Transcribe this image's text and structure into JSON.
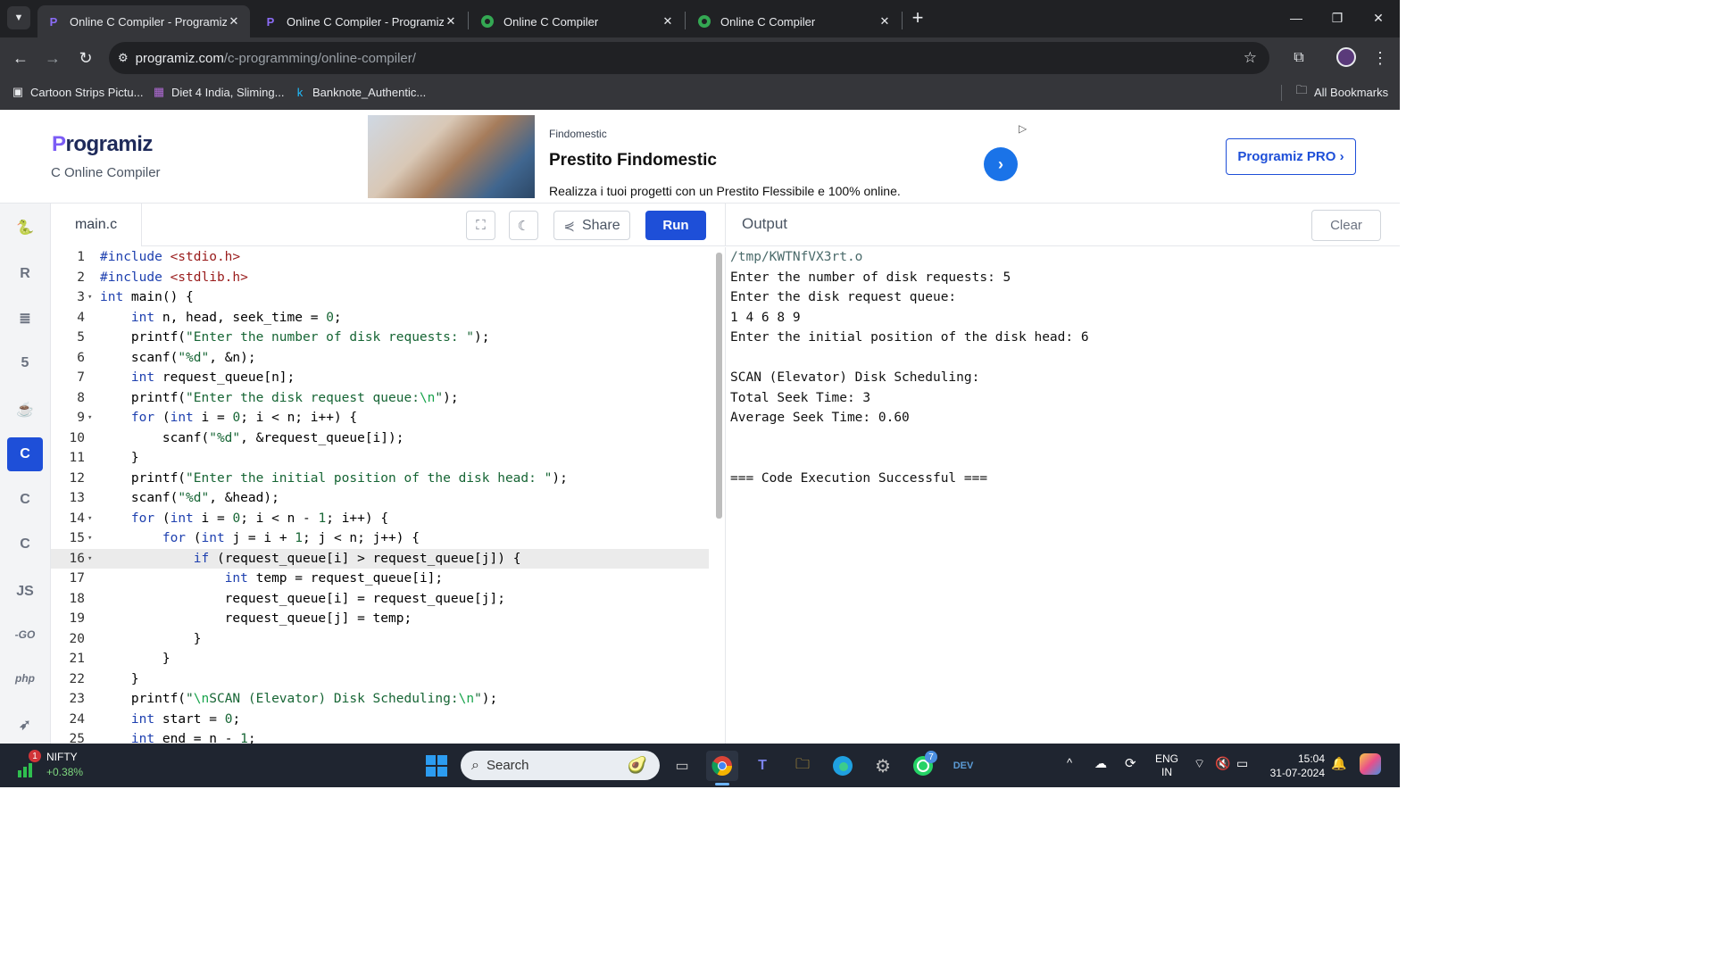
{
  "browser": {
    "tabs": [
      {
        "title": "Online C Compiler - Programiz",
        "icon": "programiz-icon",
        "active": true
      },
      {
        "title": "Online C Compiler - Programiz",
        "icon": "programiz-icon",
        "active": false
      },
      {
        "title": "Online C Compiler",
        "icon": "onlinegdb-icon",
        "active": false
      },
      {
        "title": "Online C Compiler",
        "icon": "onlinegdb-icon",
        "active": false
      }
    ],
    "new_tab": "+",
    "url_host": "programiz.com",
    "url_path": "/c-programming/online-compiler/",
    "bookmarks": [
      "Cartoon Strips Pictu...",
      "Diet 4 India, Sliming...",
      "Banknote_Authentic..."
    ],
    "all_bookmarks": "All Bookmarks"
  },
  "header": {
    "logo": "rogramiz",
    "logo_p": "P",
    "subtitle": "C Online Compiler",
    "pro_button": "Programiz PRO ›"
  },
  "ad": {
    "brand": "Findomestic",
    "title": "Prestito Findomestic",
    "desc": "Realizza i tuoi progetti con un Prestito Flessibile e 100% online."
  },
  "rail": {
    "items": [
      {
        "name": "python-icon",
        "glyph": "🐍",
        "active": false
      },
      {
        "name": "r-icon",
        "glyph": "R",
        "active": false
      },
      {
        "name": "sql-icon",
        "glyph": "≣",
        "active": false
      },
      {
        "name": "html-icon",
        "glyph": "5",
        "active": false
      },
      {
        "name": "java-icon",
        "glyph": "☕",
        "active": false
      },
      {
        "name": "c-icon",
        "glyph": "C",
        "active": true
      },
      {
        "name": "cpp-icon",
        "glyph": "C",
        "active": false
      },
      {
        "name": "csharp-icon",
        "glyph": "C",
        "active": false
      },
      {
        "name": "js-icon",
        "glyph": "JS",
        "active": false
      },
      {
        "name": "go-icon",
        "glyph": "-GO",
        "active": false
      },
      {
        "name": "php-icon",
        "glyph": "php",
        "active": false
      },
      {
        "name": "swift-icon",
        "glyph": "➶",
        "active": false
      }
    ]
  },
  "editor": {
    "filename": "main.c",
    "share_label": "Share",
    "run_label": "Run",
    "lines": [
      {
        "n": "1",
        "fold": false,
        "html": "<span class=\"pp\">#include</span> <span class=\"inc\">&lt;stdio.h&gt;</span>"
      },
      {
        "n": "2",
        "fold": false,
        "html": "<span class=\"pp\">#include</span> <span class=\"inc\">&lt;stdlib.h&gt;</span>"
      },
      {
        "n": "3",
        "fold": true,
        "html": "<span class=\"kw\">int</span> main() {"
      },
      {
        "n": "4",
        "fold": false,
        "html": "    <span class=\"kw\">int</span> n, head, seek_time = <span class=\"num\">0</span>;"
      },
      {
        "n": "5",
        "fold": false,
        "html": "    printf(<span class=\"str\">\"Enter the number of disk requests: \"</span>);"
      },
      {
        "n": "6",
        "fold": false,
        "html": "    scanf(<span class=\"str\">\"%d\"</span>, &amp;n);"
      },
      {
        "n": "7",
        "fold": false,
        "html": "    <span class=\"kw\">int</span> request_queue[n];"
      },
      {
        "n": "8",
        "fold": false,
        "html": "    printf(<span class=\"str\">\"Enter the disk request queue:<span class=\"esc\">\\n</span>\"</span>);"
      },
      {
        "n": "9",
        "fold": true,
        "html": "    <span class=\"kw\">for</span> (<span class=\"kw\">int</span> i = <span class=\"num\">0</span>; i &lt; n; i++) {"
      },
      {
        "n": "10",
        "fold": false,
        "html": "        scanf(<span class=\"str\">\"%d\"</span>, &amp;request_queue[i]);"
      },
      {
        "n": "11",
        "fold": false,
        "html": "    }"
      },
      {
        "n": "12",
        "fold": false,
        "html": "    printf(<span class=\"str\">\"Enter the initial position of the disk head: \"</span>);"
      },
      {
        "n": "13",
        "fold": false,
        "html": "    scanf(<span class=\"str\">\"%d\"</span>, &amp;head);"
      },
      {
        "n": "14",
        "fold": true,
        "html": "    <span class=\"kw\">for</span> (<span class=\"kw\">int</span> i = <span class=\"num\">0</span>; i &lt; n - <span class=\"num\">1</span>; i++) {"
      },
      {
        "n": "15",
        "fold": true,
        "html": "        <span class=\"kw\">for</span> (<span class=\"kw\">int</span> j = i + <span class=\"num\">1</span>; j &lt; n; j++) {"
      },
      {
        "n": "16",
        "fold": true,
        "hl": true,
        "html": "            <span class=\"kw\">if</span> (request_queue[i] &gt; request_queue[j]) {"
      },
      {
        "n": "17",
        "fold": false,
        "html": "                <span class=\"kw\">int</span> temp = request_queue[i];"
      },
      {
        "n": "18",
        "fold": false,
        "html": "                request_queue[i] = request_queue[j];"
      },
      {
        "n": "19",
        "fold": false,
        "html": "                request_queue[j] = temp;"
      },
      {
        "n": "20",
        "fold": false,
        "html": "            }"
      },
      {
        "n": "21",
        "fold": false,
        "html": "        }"
      },
      {
        "n": "22",
        "fold": false,
        "html": "    }"
      },
      {
        "n": "23",
        "fold": false,
        "html": "    printf(<span class=\"str\">\"<span class=\"esc\">\\n</span>SCAN (Elevator) Disk Scheduling:<span class=\"esc\">\\n</span>\"</span>);"
      },
      {
        "n": "24",
        "fold": false,
        "html": "    <span class=\"kw\">int</span> start = <span class=\"num\">0</span>;"
      },
      {
        "n": "25",
        "fold": false,
        "html": "    <span class=\"kw\">int</span> end = n - <span class=\"num\">1</span>;"
      }
    ]
  },
  "output": {
    "title": "Output",
    "clear_label": "Clear",
    "lines": [
      "/tmp/KWTNfVX3rt.o",
      "Enter the number of disk requests: 5",
      "Enter the disk request queue:",
      "1 4 6 8 9",
      "Enter the initial position of the disk head: 6",
      "",
      "SCAN (Elevator) Disk Scheduling:",
      "Total Seek Time: 3",
      "Average Seek Time: 0.60",
      "",
      "",
      "=== Code Execution Successful ==="
    ]
  },
  "taskbar": {
    "stock_name": "NIFTY",
    "stock_change": "+0.38%",
    "stock_badge": "1",
    "search_placeholder": "Search",
    "whatsapp_badge": "7",
    "lang": "ENG",
    "region": "IN",
    "time": "15:04",
    "date": "31-07-2024"
  },
  "colors": {
    "accent": "#1e4fd8",
    "keyword": "#1e40af",
    "string": "#166534"
  }
}
